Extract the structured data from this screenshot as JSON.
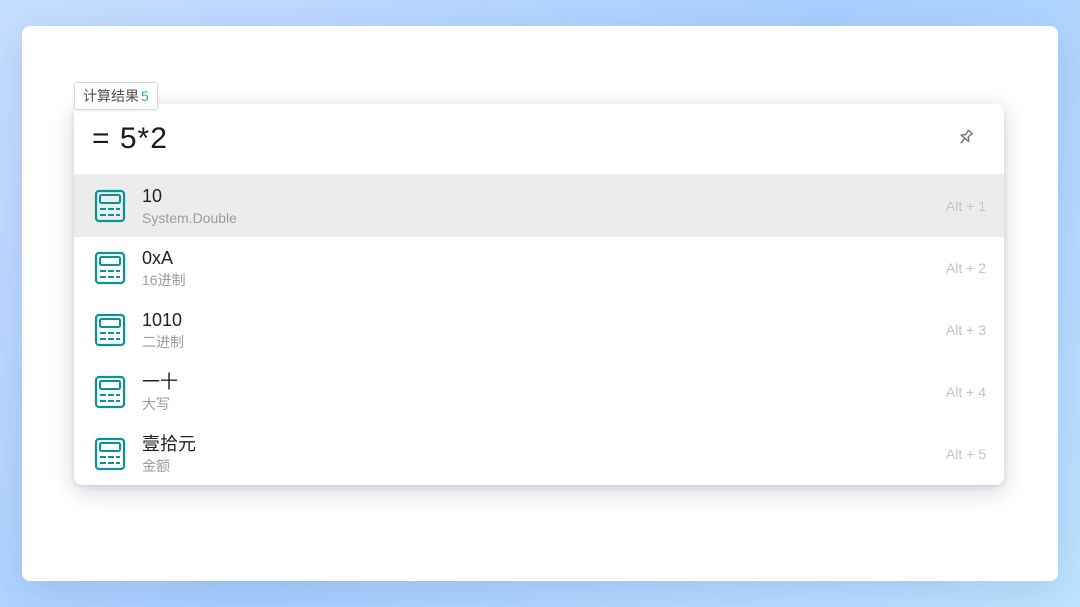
{
  "badge": {
    "label": "计算结果",
    "count": "5"
  },
  "search": {
    "value": "= 5*2"
  },
  "results": [
    {
      "title": "10",
      "subtitle": "System.Double",
      "shortcut": "Alt + 1",
      "selected": true
    },
    {
      "title": "0xA",
      "subtitle": "16进制",
      "shortcut": "Alt + 2",
      "selected": false
    },
    {
      "title": "1010",
      "subtitle": "二进制",
      "shortcut": "Alt + 3",
      "selected": false
    },
    {
      "title": "一十",
      "subtitle": "大写",
      "shortcut": "Alt + 4",
      "selected": false
    },
    {
      "title": "壹拾元",
      "subtitle": "金额",
      "shortcut": "Alt + 5",
      "selected": false
    }
  ],
  "colors": {
    "icon_accent": "#0a9396"
  }
}
